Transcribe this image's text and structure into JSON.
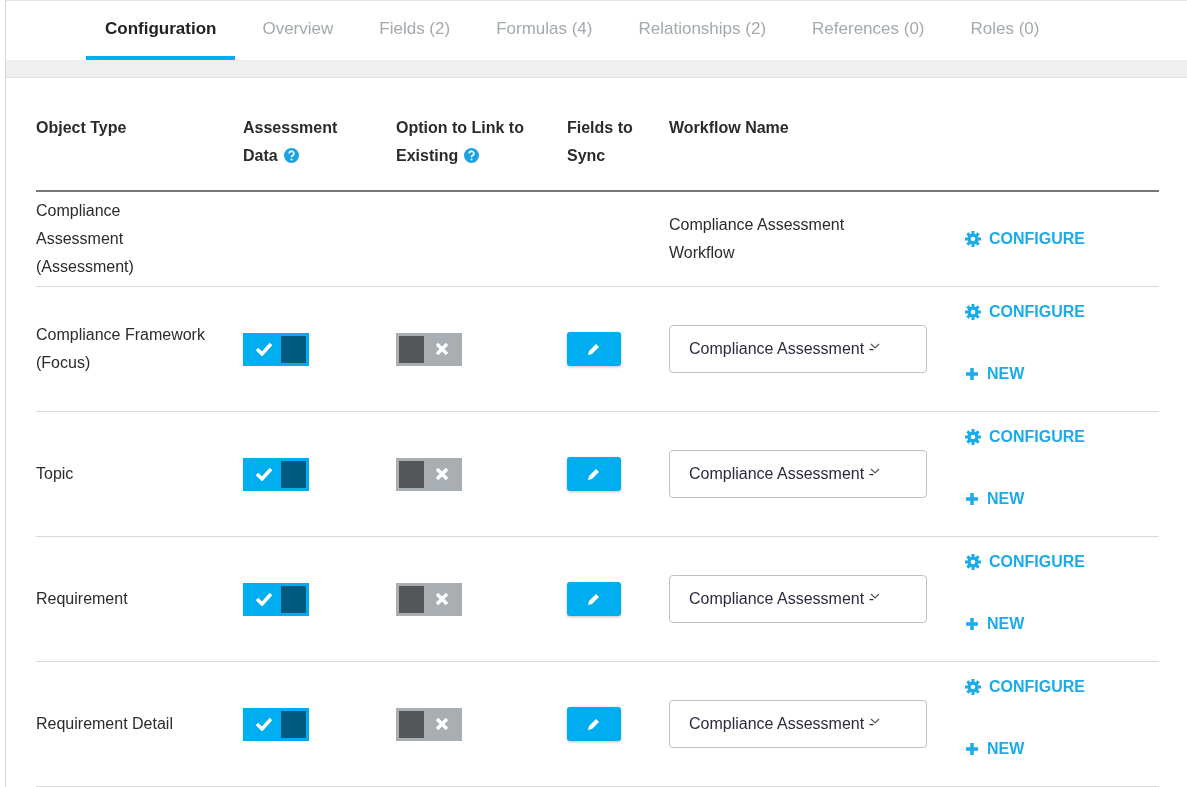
{
  "tabs": [
    {
      "label": "Configuration",
      "selected": true
    },
    {
      "label": "Overview",
      "selected": false
    },
    {
      "label": "Fields (2)",
      "selected": false
    },
    {
      "label": "Formulas (4)",
      "selected": false
    },
    {
      "label": "Relationships (2)",
      "selected": false
    },
    {
      "label": "References (0)",
      "selected": false
    },
    {
      "label": "Roles (0)",
      "selected": false
    }
  ],
  "table": {
    "columns": [
      {
        "label": "Object Type",
        "help": false
      },
      {
        "label": "Assessment Data",
        "help": true
      },
      {
        "label": "Option to Link to Existing",
        "help": true
      },
      {
        "label": "Fields to Sync",
        "help": false
      },
      {
        "label": "Workflow Name",
        "help": false
      }
    ],
    "rows": [
      {
        "kind": "root",
        "object_type": "Compliance Assessment (Assessment)",
        "workflow": "Compliance Assessment Workflow",
        "actions": [
          "CONFIGURE"
        ]
      },
      {
        "kind": "linked",
        "object_type": "Compliance Framework (Focus)",
        "assessment_data": true,
        "link_existing": false,
        "workflow": "Compliance Assessment -",
        "actions": [
          "CONFIGURE",
          "NEW"
        ]
      },
      {
        "kind": "linked",
        "object_type": "Topic",
        "assessment_data": true,
        "link_existing": false,
        "workflow": "Compliance Assessment -",
        "actions": [
          "CONFIGURE",
          "NEW"
        ]
      },
      {
        "kind": "linked",
        "object_type": "Requirement",
        "assessment_data": true,
        "link_existing": false,
        "workflow": "Compliance Assessment -",
        "actions": [
          "CONFIGURE",
          "NEW"
        ]
      },
      {
        "kind": "linked",
        "object_type": "Requirement Detail",
        "assessment_data": true,
        "link_existing": false,
        "workflow": "Compliance Assessment -",
        "actions": [
          "CONFIGURE",
          "NEW"
        ]
      }
    ]
  }
}
